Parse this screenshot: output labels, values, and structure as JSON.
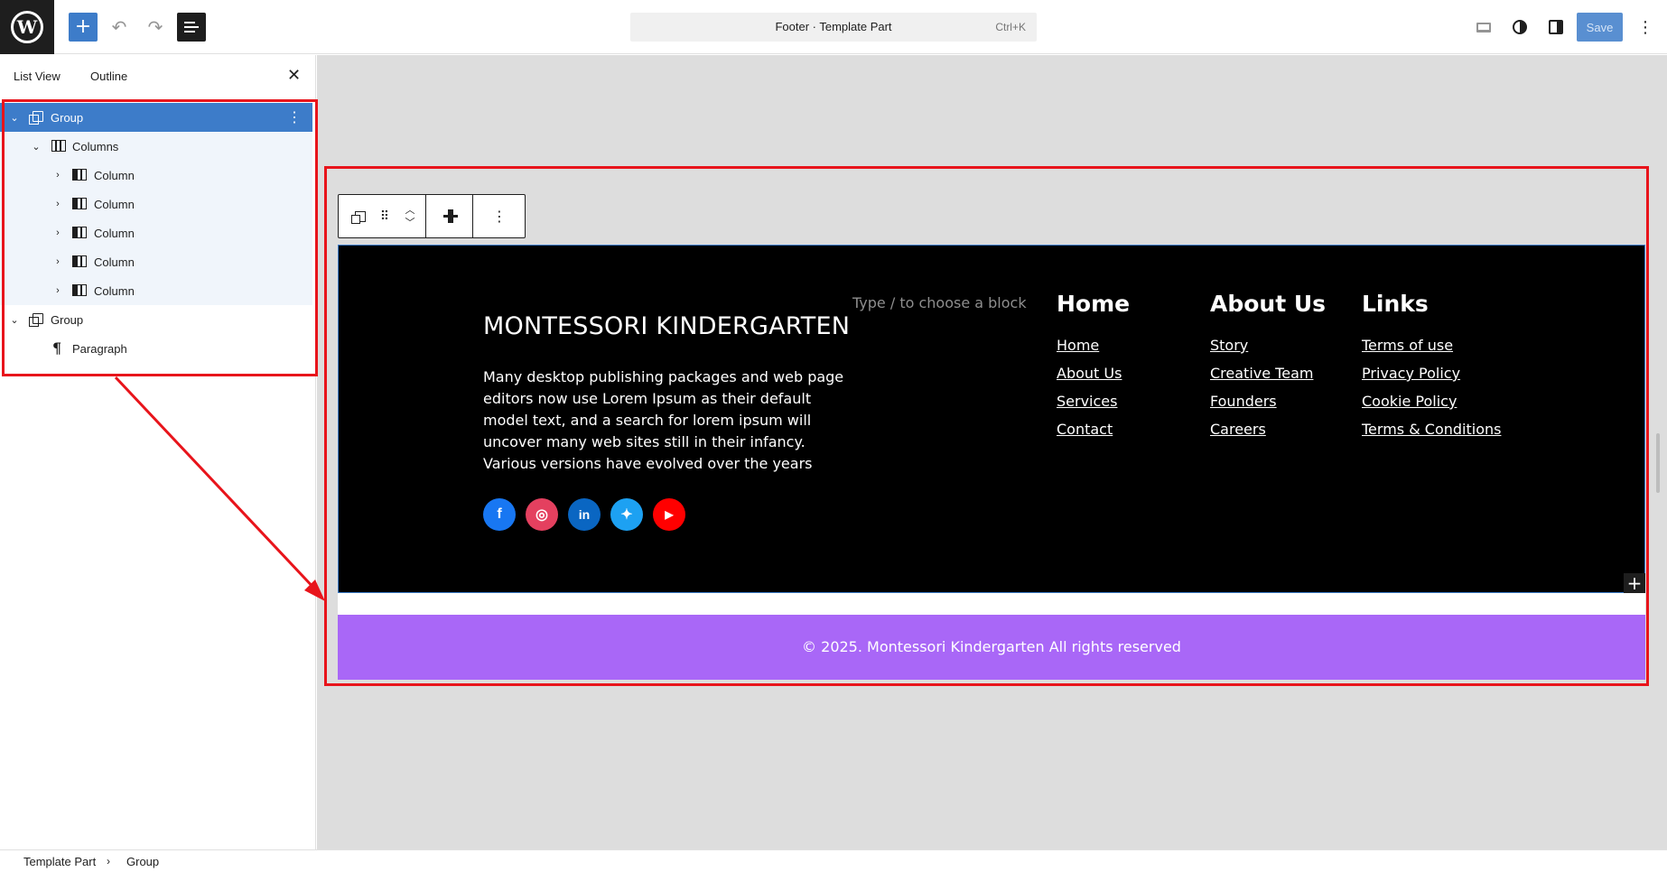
{
  "topbar": {
    "command_title": "Footer · Template Part",
    "command_shortcut": "Ctrl+K",
    "save_label": "Save",
    "accent_color": "#3d7cc9"
  },
  "sidebar": {
    "tabs": [
      "List View",
      "Outline"
    ],
    "close_icon": "close-icon",
    "tree": [
      {
        "label": "Group",
        "icon": "group-icon",
        "expanded": true,
        "selected": true
      },
      {
        "label": "Columns",
        "icon": "columns-icon",
        "expanded": true
      },
      {
        "label": "Column",
        "icon": "column-icon",
        "expanded": false
      },
      {
        "label": "Column",
        "icon": "column-icon",
        "expanded": false
      },
      {
        "label": "Column",
        "icon": "column-icon",
        "expanded": false
      },
      {
        "label": "Column",
        "icon": "column-icon",
        "expanded": false
      },
      {
        "label": "Column",
        "icon": "column-icon",
        "expanded": false
      },
      {
        "label": "Group",
        "icon": "group-icon",
        "expanded": true
      },
      {
        "label": "Paragraph",
        "icon": "paragraph-icon"
      }
    ]
  },
  "footer": {
    "site_title": "MONTESSORI KINDERGARTEN",
    "description": "Many desktop publishing packages and web page editors now use Lorem Ipsum as their default model text, and a search for lorem ipsum will uncover many web sites still in their infancy. Various versions have evolved over the years",
    "placeholder": "Type / to choose a block",
    "socials": [
      {
        "name": "facebook-icon",
        "glyph": "f",
        "color": "#1877f2"
      },
      {
        "name": "instagram-icon",
        "glyph": "◎",
        "color": "#e4405f"
      },
      {
        "name": "linkedin-icon",
        "glyph": "in",
        "color": "#0a66c2"
      },
      {
        "name": "twitter-icon",
        "glyph": "✦",
        "color": "#1da1f2"
      },
      {
        "name": "youtube-icon",
        "glyph": "▶",
        "color": "#ff0000"
      }
    ],
    "columns": [
      {
        "heading": "Home",
        "links": [
          "Home",
          "About Us",
          "Services",
          "Contact"
        ]
      },
      {
        "heading": "About Us",
        "links": [
          "Story",
          "Creative Team",
          "Founders",
          "Careers"
        ]
      },
      {
        "heading": "Links",
        "links": [
          "Terms of use",
          "Privacy Policy",
          "Cookie Policy",
          "Terms & Conditions"
        ]
      }
    ],
    "copyright": "© 2025. Montessori Kindergarten All rights reserved",
    "copyright_bg": "#a967f7"
  },
  "breadcrumb": {
    "items": [
      "Template Part",
      "Group"
    ]
  },
  "annotation_color": "#e8141b"
}
